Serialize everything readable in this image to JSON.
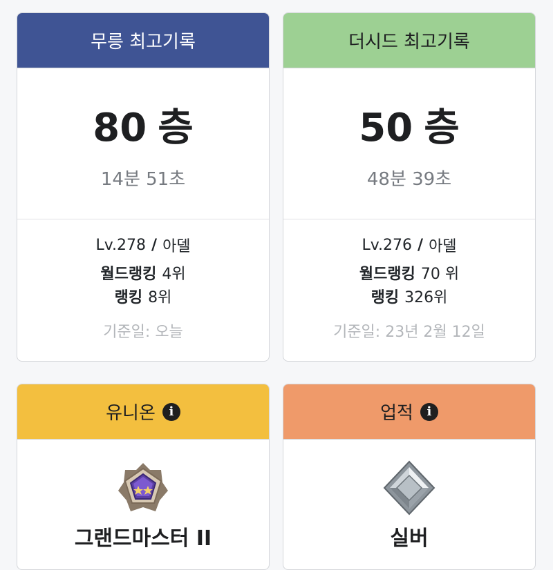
{
  "colors": {
    "mureung_header": "#3f5494",
    "dusseid_header": "#9dd093",
    "union_header": "#f3bf3f",
    "achievement_header": "#ef9a6a"
  },
  "mureung": {
    "title": "무릉 최고기록",
    "floor_value": "80",
    "floor_unit": "층",
    "time": "14분 51초",
    "level": "Lv.278",
    "slash": "/",
    "job": "아델",
    "world_rank_label": "월드랭킹",
    "world_rank_value": "4위",
    "rank_label": "랭킹",
    "rank_value": "8위",
    "date": "기준일: 오늘"
  },
  "dusseid": {
    "title": "더시드 최고기록",
    "floor_value": "50",
    "floor_unit": "층",
    "time": "48분 39초",
    "level": "Lv.276",
    "slash": "/",
    "job": "아델",
    "world_rank_label": "월드랭킹",
    "world_rank_value": "70 위",
    "rank_label": "랭킹",
    "rank_value": "326위",
    "date": "기준일: 23년 2월 12일"
  },
  "union": {
    "title": "유니온",
    "info_icon": "info-icon",
    "emblem_icon": "grandmaster-emblem-icon",
    "grade": "그랜드마스터 II"
  },
  "achievement": {
    "title": "업적",
    "info_icon": "info-icon",
    "emblem_icon": "silver-emblem-icon",
    "grade": "실버"
  }
}
